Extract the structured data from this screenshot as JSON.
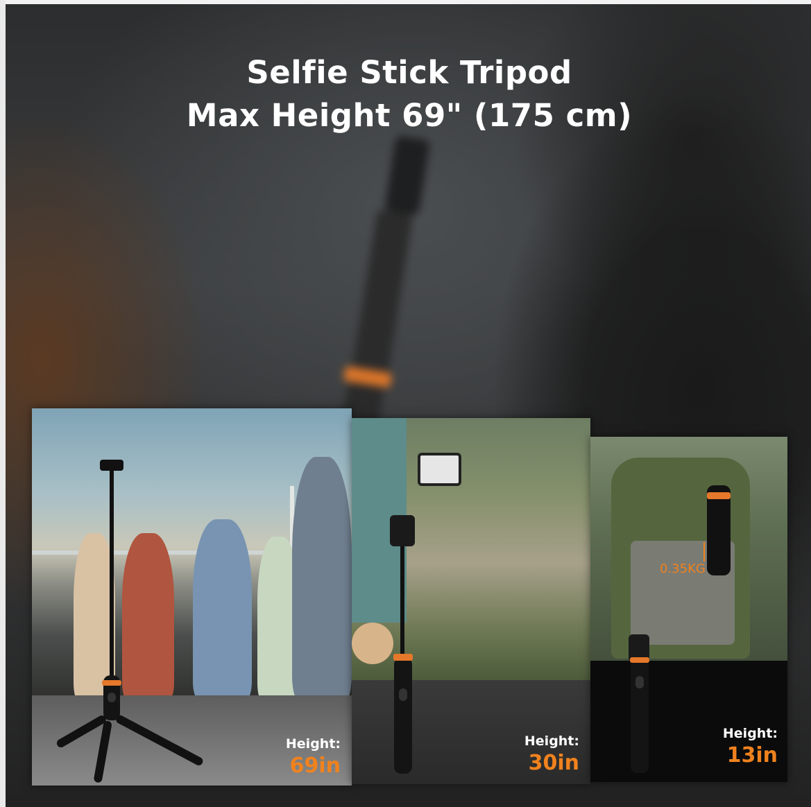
{
  "header": {
    "line1": "Selfie Stick Tripod",
    "line2": "Max Height 69\" (175 cm)"
  },
  "panels": [
    {
      "height_label": "Height:",
      "height_value": "69in"
    },
    {
      "height_label": "Height:",
      "height_value": "30in"
    },
    {
      "height_label": "Height:",
      "height_value": "13in",
      "weight": "0.35KG"
    }
  ],
  "colors": {
    "accent": "#f0821e",
    "title": "#ffffff"
  }
}
